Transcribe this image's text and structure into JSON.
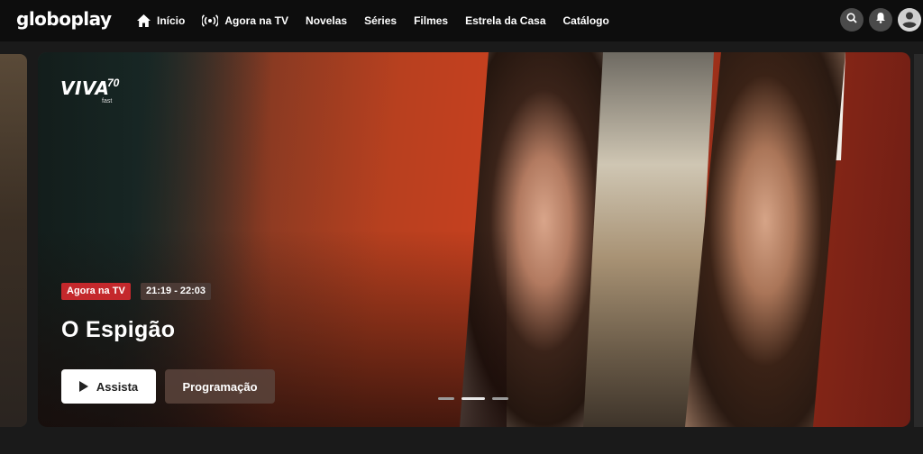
{
  "brand": {
    "logo_text": "globoplay"
  },
  "nav": {
    "items": [
      {
        "label": "Início",
        "icon": "home-icon"
      },
      {
        "label": "Agora na TV",
        "icon": "live-broadcast-icon"
      },
      {
        "label": "Novelas"
      },
      {
        "label": "Séries"
      },
      {
        "label": "Filmes"
      },
      {
        "label": "Estrela da Casa"
      },
      {
        "label": "Catálogo"
      }
    ],
    "right_icons": [
      "search-icon",
      "bell-icon",
      "user-avatar-icon"
    ]
  },
  "hero": {
    "channel_logo": {
      "name": "VIVA",
      "number": "70",
      "tag": "fast"
    },
    "live_badge": "Agora na TV",
    "time_range": "21:19 - 22:03",
    "title": "O Espigão",
    "primary_button": "Assista",
    "secondary_button": "Programação",
    "carousel": {
      "total": 3,
      "active_index": 1
    }
  },
  "colors": {
    "accent_red": "#c4282c",
    "topbar_bg": "#0d0d0d",
    "page_bg": "#1c1c1c"
  }
}
